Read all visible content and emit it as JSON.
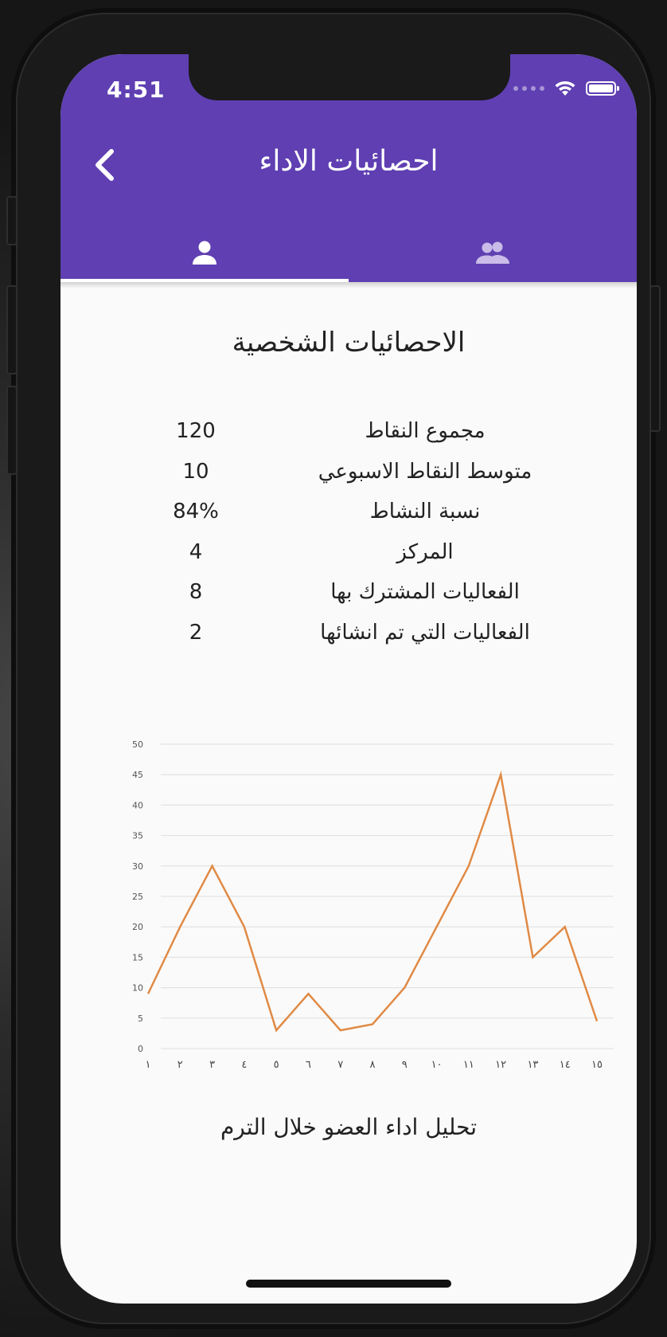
{
  "status_bar": {
    "time": "4:51"
  },
  "app_bar": {
    "title": "احصائيات الاداء",
    "tabs": [
      {
        "icon": "person-icon",
        "active": true
      },
      {
        "icon": "group-icon",
        "active": false
      }
    ],
    "color": "#5f3fb2"
  },
  "personal_stats": {
    "heading": "الاحصائيات الشخصية",
    "rows": [
      {
        "label": "مجموع النقاط",
        "value": "120"
      },
      {
        "label": "متوسط النقاط الاسبوعي",
        "value": "10"
      },
      {
        "label": "نسبة النشاط",
        "value": "84%"
      },
      {
        "label": "المركز",
        "value": "4"
      },
      {
        "label": "الفعاليات المشترك بها",
        "value": "8"
      },
      {
        "label": "الفعاليات التي تم انشائها",
        "value": "2"
      }
    ]
  },
  "chart_data": {
    "type": "line",
    "categories": [
      "١",
      "٢",
      "٣",
      "٤",
      "٥",
      "٦",
      "٧",
      "٨",
      "٩",
      "١٠",
      "١١",
      "١٢",
      "١٣",
      "١٤",
      "١٥"
    ],
    "values": [
      9,
      20,
      30,
      20,
      3,
      9,
      3,
      4,
      10,
      20,
      30,
      45,
      15,
      20,
      4.5
    ],
    "ylim": [
      0,
      50
    ],
    "yticks": [
      0,
      5,
      10,
      15,
      20,
      25,
      30,
      35,
      40,
      45,
      50
    ],
    "grid": true,
    "line_color": "#e08a45"
  },
  "caption": "تحليل اداء العضو خلال الترم"
}
